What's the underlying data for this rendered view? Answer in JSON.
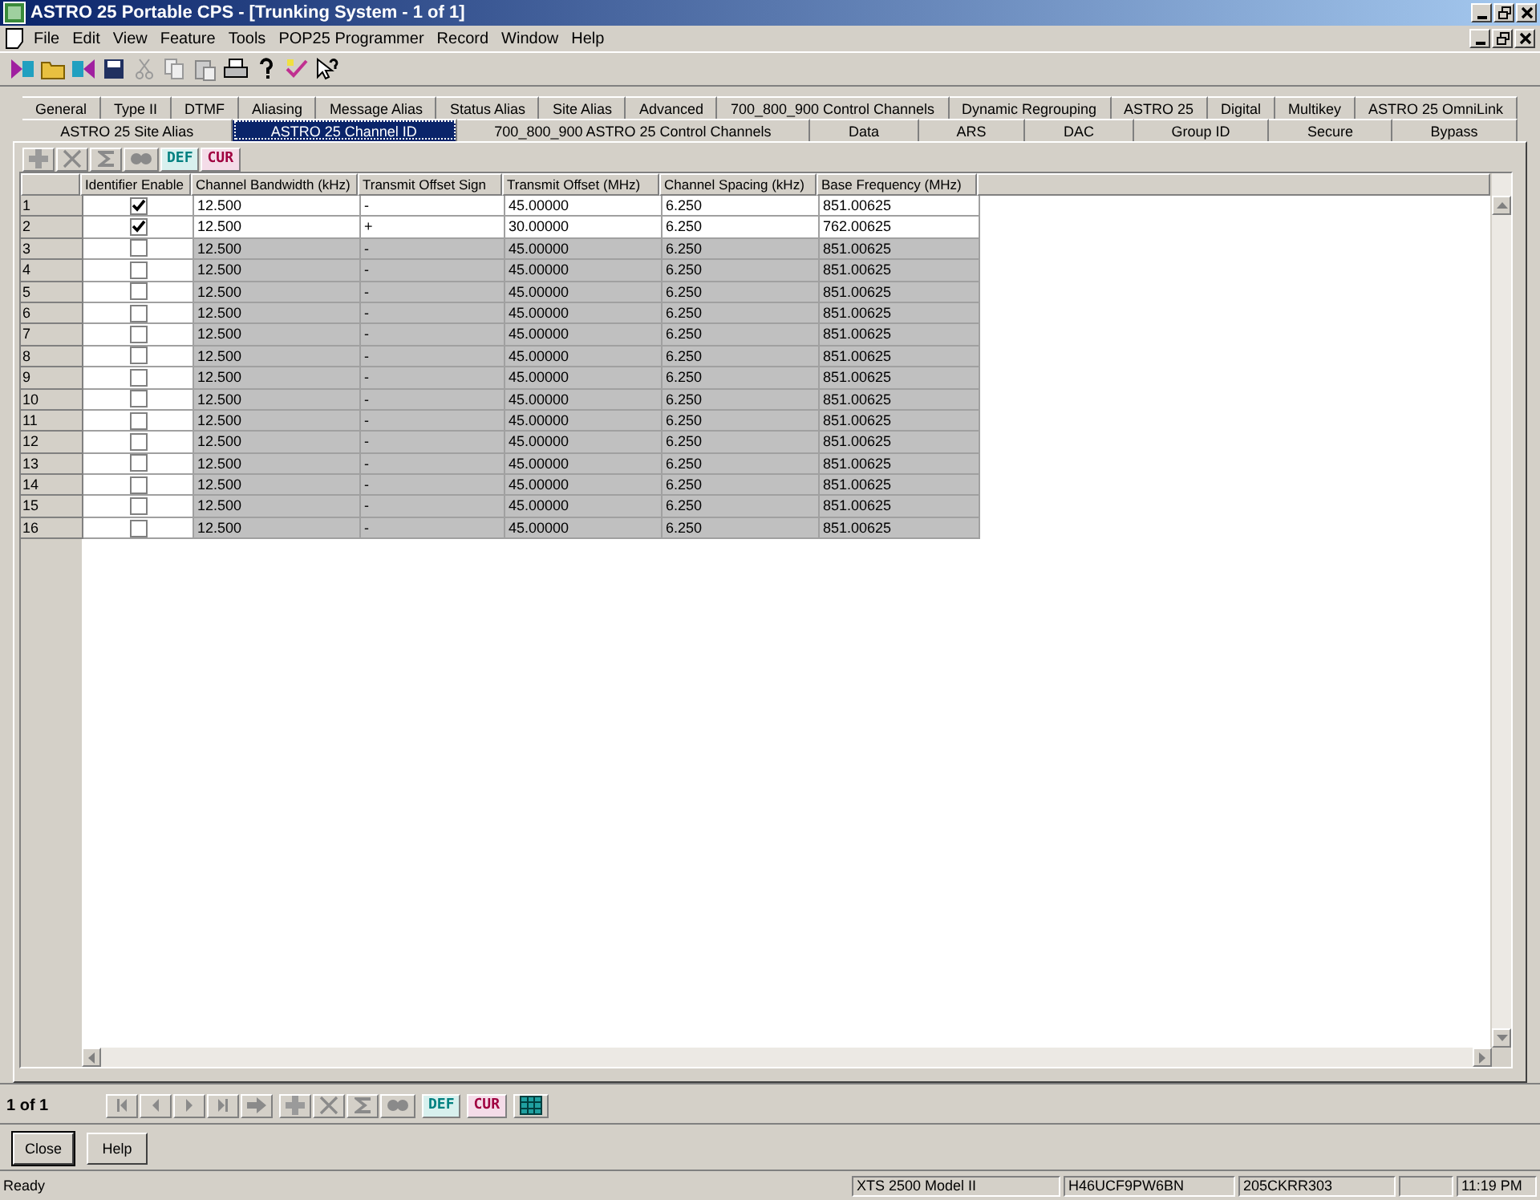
{
  "window": {
    "title": "ASTRO 25 Portable CPS - [Trunking System - 1 of 1]"
  },
  "menu": [
    "File",
    "Edit",
    "View",
    "Feature",
    "Tools",
    "POP25 Programmer",
    "Record",
    "Window",
    "Help"
  ],
  "tabs": [
    [
      {
        "label": "General",
        "selected": false
      },
      {
        "label": "Type II",
        "selected": false
      },
      {
        "label": "DTMF",
        "selected": false
      },
      {
        "label": "Aliasing",
        "selected": false
      },
      {
        "label": "Message Alias",
        "selected": false
      },
      {
        "label": "Status Alias",
        "selected": false
      },
      {
        "label": "Site Alias",
        "selected": false
      },
      {
        "label": "Advanced",
        "selected": false
      },
      {
        "label": "700_800_900 Control Channels",
        "selected": false
      },
      {
        "label": "Dynamic Regrouping",
        "selected": false
      },
      {
        "label": "ASTRO 25",
        "selected": false
      },
      {
        "label": "Digital",
        "selected": false
      },
      {
        "label": "Multikey",
        "selected": false
      },
      {
        "label": "ASTRO 25 OmniLink",
        "selected": false
      }
    ],
    [
      {
        "label": "ASTRO 25 Site Alias",
        "selected": false
      },
      {
        "label": "ASTRO 25 Channel ID",
        "selected": true
      },
      {
        "label": "700_800_900 ASTRO 25 Control Channels",
        "selected": false
      },
      {
        "label": "Data",
        "selected": false
      },
      {
        "label": "ARS",
        "selected": false
      },
      {
        "label": "DAC",
        "selected": false
      },
      {
        "label": "Group ID",
        "selected": false
      },
      {
        "label": "Secure",
        "selected": false
      },
      {
        "label": "Bypass",
        "selected": false
      }
    ]
  ],
  "grid_toolbar": {
    "def": "DEF",
    "cur": "CUR"
  },
  "grid": {
    "checkbox_column": "Identifier Enable",
    "columns": [
      "Channel Bandwidth (kHz)",
      "Transmit Offset Sign",
      "Transmit Offset (MHz)",
      "Channel Spacing (kHz)",
      "Base Frequency (MHz)"
    ],
    "rows": [
      {
        "number": "1",
        "checked": true,
        "cells": [
          "12.500",
          "-",
          "45.00000",
          "6.250",
          "851.00625"
        ]
      },
      {
        "number": "2",
        "checked": true,
        "cells": [
          "12.500",
          "+",
          "30.00000",
          "6.250",
          "762.00625"
        ]
      },
      {
        "number": "3",
        "checked": false,
        "cells": [
          "12.500",
          "-",
          "45.00000",
          "6.250",
          "851.00625"
        ]
      },
      {
        "number": "4",
        "checked": false,
        "cells": [
          "12.500",
          "-",
          "45.00000",
          "6.250",
          "851.00625"
        ]
      },
      {
        "number": "5",
        "checked": false,
        "cells": [
          "12.500",
          "-",
          "45.00000",
          "6.250",
          "851.00625"
        ]
      },
      {
        "number": "6",
        "checked": false,
        "cells": [
          "12.500",
          "-",
          "45.00000",
          "6.250",
          "851.00625"
        ]
      },
      {
        "number": "7",
        "checked": false,
        "cells": [
          "12.500",
          "-",
          "45.00000",
          "6.250",
          "851.00625"
        ]
      },
      {
        "number": "8",
        "checked": false,
        "cells": [
          "12.500",
          "-",
          "45.00000",
          "6.250",
          "851.00625"
        ]
      },
      {
        "number": "9",
        "checked": false,
        "cells": [
          "12.500",
          "-",
          "45.00000",
          "6.250",
          "851.00625"
        ]
      },
      {
        "number": "10",
        "checked": false,
        "cells": [
          "12.500",
          "-",
          "45.00000",
          "6.250",
          "851.00625"
        ]
      },
      {
        "number": "11",
        "checked": false,
        "cells": [
          "12.500",
          "-",
          "45.00000",
          "6.250",
          "851.00625"
        ]
      },
      {
        "number": "12",
        "checked": false,
        "cells": [
          "12.500",
          "-",
          "45.00000",
          "6.250",
          "851.00625"
        ]
      },
      {
        "number": "13",
        "checked": false,
        "cells": [
          "12.500",
          "-",
          "45.00000",
          "6.250",
          "851.00625"
        ]
      },
      {
        "number": "14",
        "checked": false,
        "cells": [
          "12.500",
          "-",
          "45.00000",
          "6.250",
          "851.00625"
        ]
      },
      {
        "number": "15",
        "checked": false,
        "cells": [
          "12.500",
          "-",
          "45.00000",
          "6.250",
          "851.00625"
        ]
      },
      {
        "number": "16",
        "checked": false,
        "cells": [
          "12.500",
          "-",
          "45.00000",
          "6.250",
          "851.00625"
        ]
      }
    ]
  },
  "navigator": {
    "position": "1 of 1",
    "def": "DEF",
    "cur": "CUR"
  },
  "buttons": [
    "Close",
    "Help"
  ],
  "status_bar": {
    "message": "Ready",
    "panes": [
      "XTS 2500 Model II",
      "H46UCF9PW6BN",
      "205CKRR303"
    ],
    "time": "11:19 PM"
  }
}
